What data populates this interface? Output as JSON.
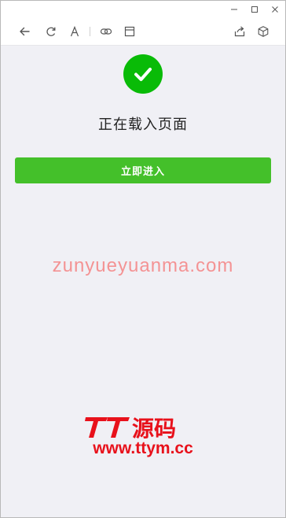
{
  "titlebar": {
    "controls": [
      "minimize-icon",
      "maximize-icon",
      "close-icon"
    ]
  },
  "toolbar": {
    "left_icons": [
      "back-arrow-icon",
      "refresh-icon",
      "font-size-icon",
      "link-icon",
      "window-icon"
    ],
    "right_icons": [
      "share-icon",
      "cube-icon"
    ]
  },
  "page": {
    "status_icon": "success-check-icon",
    "status_text": "正在载入页面",
    "enter_button_label": "立即进入"
  },
  "watermarks": {
    "domain_text": "zunyueyuanma.com",
    "logo_text": "TT源码",
    "logo_url": "www.ttym.cc"
  },
  "colors": {
    "accent_green": "#44c02a",
    "success_green": "#09bb07",
    "watermark_red": "#e8111b"
  }
}
